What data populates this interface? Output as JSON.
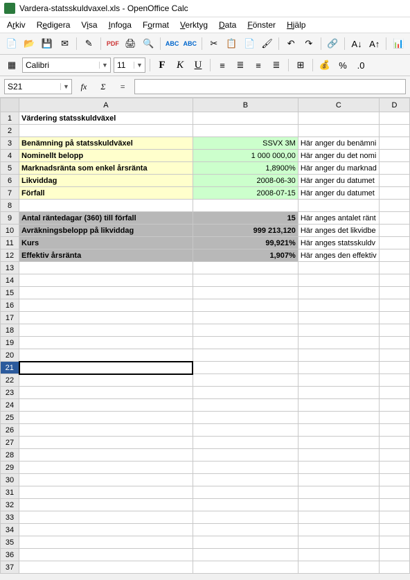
{
  "window": {
    "title": "Vardera-statsskuldvaxel.xls - OpenOffice Calc"
  },
  "menu": {
    "file": {
      "pre": "A",
      "und": "r",
      "post": "kiv"
    },
    "edit": {
      "pre": "R",
      "und": "e",
      "post": "digera"
    },
    "view": {
      "pre": "V",
      "und": "i",
      "post": "sa"
    },
    "insert": {
      "pre": "",
      "und": "I",
      "post": "nfoga"
    },
    "format": {
      "pre": "F",
      "und": "o",
      "post": "rmat"
    },
    "tools": {
      "pre": "",
      "und": "V",
      "post": "erktyg"
    },
    "data": {
      "pre": "",
      "und": "D",
      "post": "ata"
    },
    "window": {
      "pre": "",
      "und": "F",
      "post": "önster"
    },
    "help": {
      "pre": "",
      "und": "H",
      "post": "jälp"
    }
  },
  "toolbar": {
    "font": "Calibri",
    "size": "11",
    "bold": "F",
    "italic": "K",
    "underline": "U"
  },
  "formulabar": {
    "cellref": "S21",
    "fx": "fx",
    "sigma": "Σ",
    "eq": "="
  },
  "columns": [
    "A",
    "B",
    "C",
    "D"
  ],
  "rows": {
    "1": {
      "A": "Värdering statsskuldväxel"
    },
    "3": {
      "A": "Benämning på statsskuldväxel",
      "B": "SSVX 3M",
      "C": "Här anger du benämni"
    },
    "4": {
      "A": "Nominellt belopp",
      "B": "1 000 000,00",
      "C": "Här anger du det nomi"
    },
    "5": {
      "A": "Marknadsränta som enkel årsränta",
      "B": "1,8900%",
      "C": "Här anger du marknad"
    },
    "6": {
      "A": "Likviddag",
      "B": "2008-06-30",
      "C": "Här anger du datumet"
    },
    "7": {
      "A": "Förfall",
      "B": "2008-07-15",
      "C": "Här anger du datumet"
    },
    "9": {
      "A": "Antal räntedagar (360) till förfall",
      "B": "15",
      "C": "Här anges antalet ränt"
    },
    "10": {
      "A": "Avräkningsbelopp på likviddag",
      "B": "999 213,120",
      "C": "Här anges det likvidbe"
    },
    "11": {
      "A": "Kurs",
      "B": "99,921%",
      "C": "Här anges statsskuldv"
    },
    "12": {
      "A": "Effektiv årsränta",
      "B": "1,907%",
      "C": "Här anges den effektiv"
    }
  }
}
